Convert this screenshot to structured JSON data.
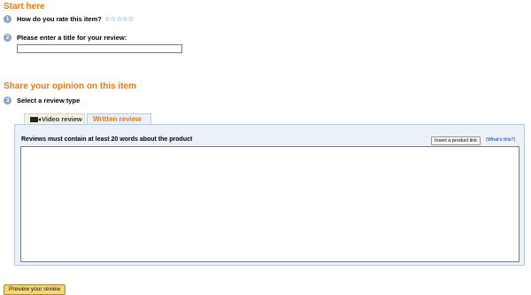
{
  "sections": {
    "start_here": "Start here",
    "share_opinion": "Share your opinion on this item"
  },
  "steps": {
    "rate": {
      "num": "1",
      "label": "How do you rate this item?"
    },
    "title": {
      "num": "2",
      "label": "Please enter a title for your review:",
      "value": ""
    },
    "type": {
      "num": "3",
      "label": "Select a review type"
    }
  },
  "rating": {
    "stars": [
      "☆",
      "☆",
      "☆",
      "☆",
      "☆"
    ],
    "selected": 0
  },
  "tabs": {
    "video": "Video review",
    "written": "Written review"
  },
  "panel": {
    "instruction": "Reviews must contain at least 20 words about the product",
    "insert_link_button": "Insert a product link",
    "whats_this": "(What's this?)",
    "review_text": ""
  },
  "footer": {
    "preview_button": "Preview your review"
  }
}
